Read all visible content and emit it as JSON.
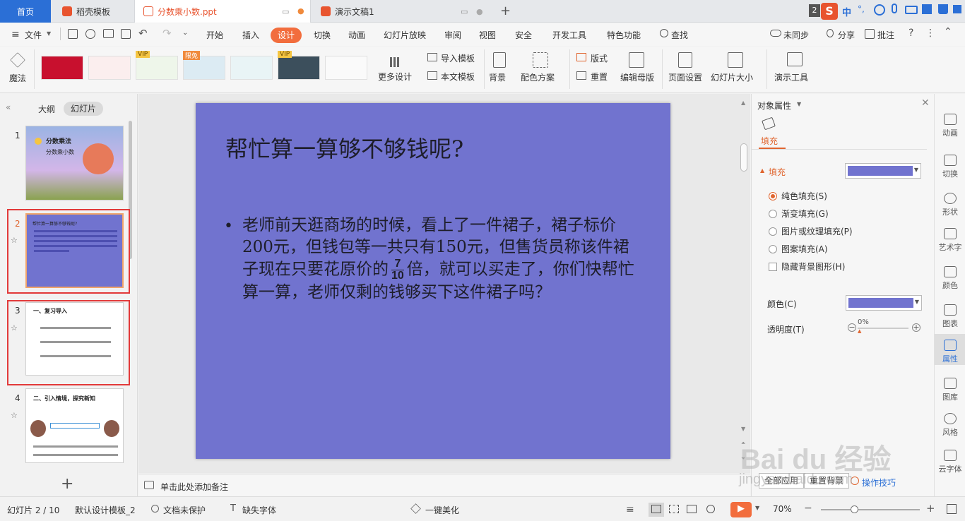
{
  "tabs": {
    "home": "首页",
    "template": "稻壳模板",
    "ppt": "分数乘小数.ppt",
    "demo": "演示文稿1",
    "add": "+"
  },
  "tray": {
    "badge": "2",
    "ime": "中"
  },
  "menu": {
    "file": "文件",
    "items": [
      "开始",
      "插入",
      "设计",
      "切换",
      "动画",
      "幻灯片放映",
      "审阅",
      "视图",
      "安全",
      "开发工具",
      "特色功能"
    ],
    "search": "查找",
    "sync": "未同步",
    "share": "分享",
    "comment": "批注"
  },
  "ribbon": {
    "magic": "魔法",
    "thumb_labels": [
      "VIP",
      "限免",
      "VIP"
    ],
    "more_design": "更多设计",
    "import_template": "导入模板",
    "this_template": "本文模板",
    "background": "背景",
    "color_scheme": "配色方案",
    "layout": "版式",
    "reset": "重置",
    "edit_master": "编辑母版",
    "page_setup": "页面设置",
    "slide_size": "幻灯片大小",
    "present_tools": "演示工具"
  },
  "leftpanel": {
    "outline": "大纲",
    "slides": "幻灯片",
    "numbers": [
      "1",
      "2",
      "3",
      "4"
    ],
    "thumb1_title": "分数乘法",
    "thumb1_sub": "分数乘小数",
    "thumb2_title": "帮忙算一算够不够钱呢?",
    "thumb3_title": "一、复习导入",
    "thumb4_title": "二、引入情境，探究新知",
    "add": "+"
  },
  "slide": {
    "title": "帮忙算一算够不够钱呢?",
    "body_1": "老师前天逛商场的时候，看上了一件裙子，裙子标价200元，但钱包等一共只有150元，但售货员称该件裙子现在只要花原价的",
    "frac_num": "7",
    "frac_den": "10",
    "body_2": "倍，就可以买走了，你们快帮忙算一算，老师仅剩的钱够买下这件裙子吗？",
    "bg_color": "#7173cf"
  },
  "notes": {
    "placeholder": "单击此处添加备注"
  },
  "props": {
    "header": "对象属性",
    "tab_fill": "填充",
    "section_fill": "填充",
    "options": [
      "纯色填充(S)",
      "渐变填充(G)",
      "图片或纹理填充(P)",
      "图案填充(A)"
    ],
    "hide_bg": "隐藏背景图形(H)",
    "color_label": "颜色(C)",
    "transparency_label": "透明度(T)",
    "transparency_value": "0%",
    "apply_all": "全部应用",
    "reset_bg": "重置背景",
    "tips": "操作技巧",
    "fill_color": "#7173cf"
  },
  "sidebar": [
    "动画",
    "切换",
    "形状",
    "艺术字",
    "颜色",
    "图表",
    "属性",
    "图库",
    "风格",
    "云字体"
  ],
  "status": {
    "slide_pos": "幻灯片 2 / 10",
    "template": "默认设计模板_2",
    "protect": "文档未保护",
    "font": "缺失字体",
    "beautify": "一键美化",
    "zoom": "70%"
  },
  "watermark": {
    "logo": "Bai du 经验",
    "url": "jingyan.baidu.com"
  }
}
